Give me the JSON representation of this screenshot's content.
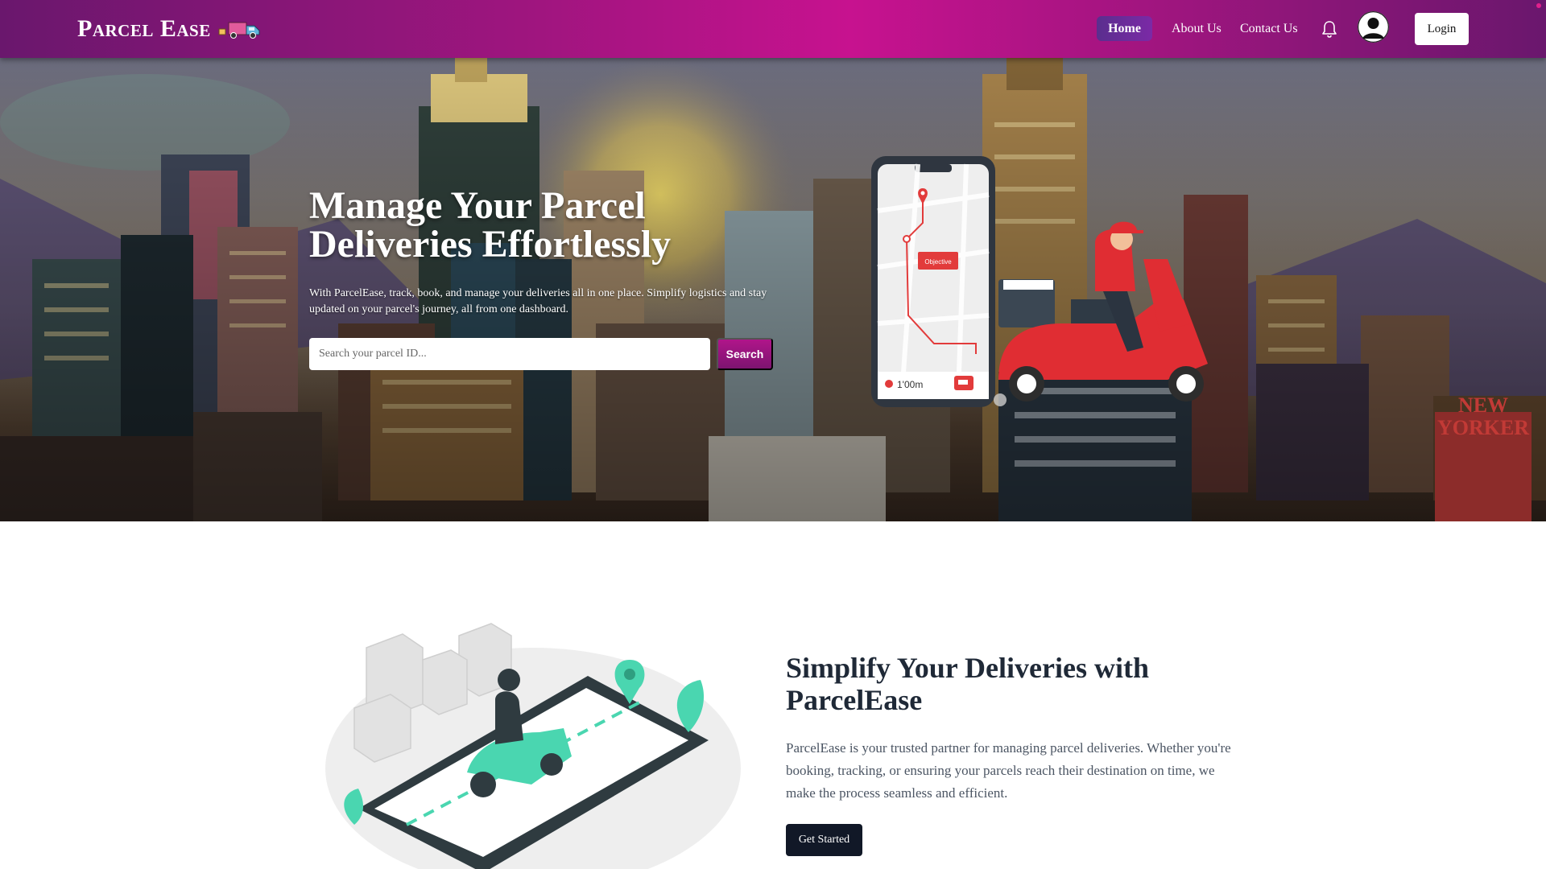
{
  "nav": {
    "brand": "Parcel Ease",
    "home": "Home",
    "about": "About Us",
    "contact": "Contact Us",
    "login": "Login"
  },
  "hero": {
    "title": "Manage Your Parcel Deliveries Effortlessly",
    "description": "With ParcelEase, track, book, and manage your deliveries all in one place. Simplify logistics and stay updated on your parcel's journey, all from one dashboard.",
    "search_placeholder": "Search your parcel ID...",
    "search_button": "Search",
    "phone_tag": "Objective",
    "phone_distance": "1'00m",
    "billboard_line1": "NEW",
    "billboard_line2": "YORKER"
  },
  "about": {
    "title": "Simplify Your Deliveries with ParcelEase",
    "text": "ParcelEase is your trusted partner for managing parcel deliveries. Whether you're booking, tracking, or ensuring your parcels reach their destination on time, we make the process seamless and efficient.",
    "button": "Get Started"
  },
  "colors": {
    "nav_gradient_center": "#c7128f",
    "nav_gradient_edge": "#6a176d",
    "search_button": "#a0157f",
    "cta_button": "#111827",
    "heading": "#1f2937",
    "illustration_accent": "#4ad6b0"
  },
  "icons": [
    "truck-icon",
    "bell-icon",
    "user-avatar-icon",
    "map-pin-icon",
    "chat-icon"
  ]
}
